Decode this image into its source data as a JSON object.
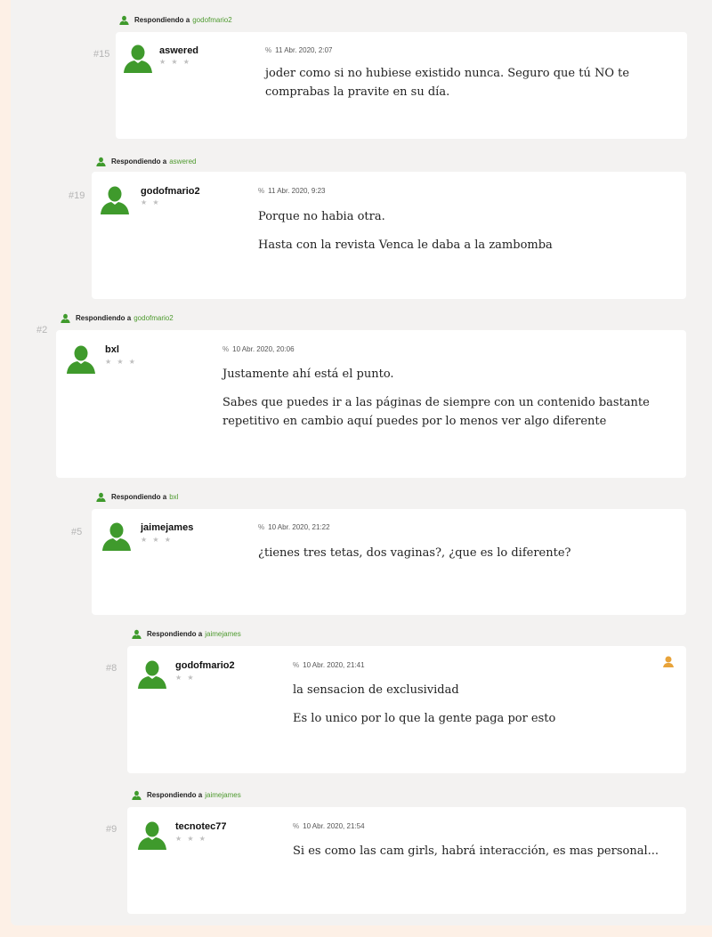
{
  "reply_prefix": "Respondiendo a",
  "comments": [
    {
      "number": "#15",
      "reply_to": "godofmario2",
      "user": "aswered",
      "stars": "★ ★ ★",
      "date": "11 Abr. 2020, 2:07",
      "paragraphs": [
        "joder como si no hubiese existido nunca. Seguro que tú NO te comprabas la pravite en su día."
      ]
    },
    {
      "number": "#19",
      "reply_to": "aswered",
      "user": "godofmario2",
      "stars": "★ ★",
      "date": "11 Abr. 2020, 9:23",
      "paragraphs": [
        "Porque no habia otra.",
        "Hasta con la revista Venca le daba a la zambomba"
      ]
    },
    {
      "number": "#2",
      "reply_to": "godofmario2",
      "user": "bxl",
      "stars": "★ ★ ★",
      "date": "10 Abr. 2020, 20:06",
      "paragraphs": [
        "Justamente ahí está el punto.",
        "Sabes que puedes ir a las páginas de siempre con un contenido bastante repetitivo en cambio aquí puedes por lo menos ver algo diferente"
      ]
    },
    {
      "number": "#5",
      "reply_to": "bxl",
      "user": "jaimejames",
      "stars": "★ ★ ★",
      "date": "10 Abr. 2020, 21:22",
      "paragraphs": [
        "¿tienes tres tetas, dos vaginas?, ¿que es lo diferente?"
      ]
    },
    {
      "number": "#8",
      "reply_to": "jaimejames",
      "user": "godofmario2",
      "stars": "★ ★",
      "date": "10 Abr. 2020, 21:41",
      "paragraphs": [
        "la sensacion de exclusividad",
        "Es lo unico por lo que la gente paga por esto"
      ]
    },
    {
      "number": "#9",
      "reply_to": "jaimejames",
      "user": "tecnotec77",
      "stars": "★ ★ ★",
      "date": "10 Abr. 2020, 21:54",
      "paragraphs": [
        "Si es como las cam girls, habrá interacción, es mas personal..."
      ]
    }
  ],
  "colors": {
    "accent": "#4e9a2f",
    "avatar": "#3f9a2c",
    "badge": "#e8a33a"
  },
  "icons": {
    "avatar": "user-avatar-icon",
    "link": "link-icon",
    "reply": "user-icon",
    "badge": "owner-badge-icon"
  }
}
